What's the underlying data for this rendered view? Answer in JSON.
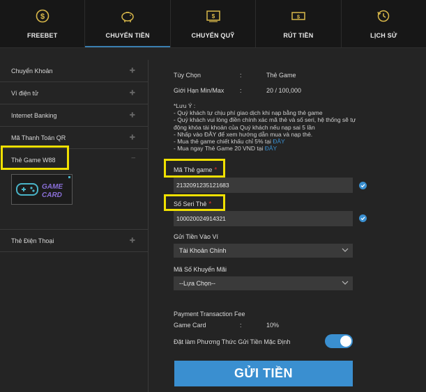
{
  "nav": {
    "tabs": [
      {
        "label": "FREEBET",
        "icon": "dollar-coin-icon"
      },
      {
        "label": "CHUYỂN TIỀN",
        "icon": "piggy-bank-icon"
      },
      {
        "label": "CHUYỂN QUỸ",
        "icon": "transfer-icon"
      },
      {
        "label": "RÚT TIỀN",
        "icon": "cash-icon"
      },
      {
        "label": "LỊCH SỬ",
        "icon": "history-icon"
      }
    ],
    "active_index": 1
  },
  "sidebar": {
    "items": [
      {
        "label": "Chuyển Khoản"
      },
      {
        "label": "Ví điện tử"
      },
      {
        "label": "Internet Banking"
      },
      {
        "label": "Mã Thanh Toán QR"
      },
      {
        "label": "Thẻ Game W88"
      },
      {
        "label": "Thẻ Điện Thoại"
      }
    ],
    "gamecard_logo": {
      "line1": "GAME",
      "line2": "CARD"
    }
  },
  "form": {
    "option_label": "Tùy Chọn",
    "option_colon": ":",
    "option_value": "Thẻ Game",
    "limit_label": "Giới Hạn Min/Max",
    "limit_colon": ":",
    "limit_value": "20 / 100,000",
    "notes": {
      "title": "*Lưu Ý :",
      "line1": "- Quý khách tự chịu phí giao dịch khi nạp bằng thẻ game",
      "line2": "- Quý khách vui lòng điền chính xác mã thẻ và số seri, hệ thống sẽ tự động khóa tài khoản của Quý khách nếu nạp sai 5 lần",
      "line3": "- Nhấp vào ĐÂY để xem hướng dẫn mua và nạp thẻ.",
      "line4_text": "- Mua thẻ game chiết khấu chỉ 5% tại",
      "line4_link": "ĐÂY",
      "line5_text": "- Mua ngay Thẻ Game 20 VND tại",
      "line5_link": "ĐÂY"
    },
    "card_code_label": "Mã Thẻ game",
    "card_code_value": "2132091235121683",
    "serial_label": "Số Seri Thẻ",
    "serial_value": "100020024914321",
    "required_mark": "*",
    "wallet_label": "Gửi Tiền Vào Ví",
    "wallet_value": "Tài Khoản Chính",
    "promo_label": "Mã Số Khuyến Mãi",
    "promo_value": "--Lựa Chọn--",
    "fee_title": "Payment Transaction Fee",
    "fee_name": "Game Card",
    "fee_colon": ":",
    "fee_value": "10%",
    "default_method_label": "Đặt làm Phương Thức Gửi Tiền Mặc Định",
    "default_method_on": true,
    "submit_label": "GỬI TIỀN"
  },
  "colors": {
    "accent": "#3a8fd0",
    "highlight": "#f0e000",
    "required": "#e03030",
    "background": "#242424",
    "nav_background": "#171717"
  }
}
